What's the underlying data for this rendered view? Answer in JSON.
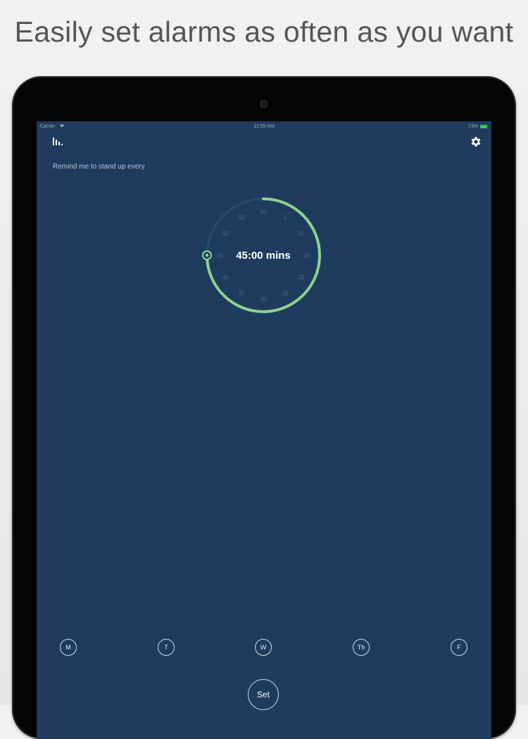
{
  "headline": "Easily set alarms as often as you want",
  "status_bar": {
    "carrier": "Carrier",
    "time": "12:55 AM",
    "battery": "73%"
  },
  "icons": {
    "stats": "bar-chart-icon",
    "settings": "gear-icon",
    "wifi": "wifi-icon"
  },
  "prompt": "Remind me to stand up every",
  "timer": {
    "display": "45:00 mins",
    "minutes_selected": 45,
    "tick_labels": [
      "50",
      "5",
      "10",
      "15",
      "20",
      "25",
      "30",
      "35",
      "40",
      "45",
      "50",
      "55"
    ],
    "accent_color": "#8fd18f",
    "track_color": "#2c4a6d"
  },
  "days": [
    "M",
    "T",
    "W",
    "Th",
    "F"
  ],
  "set_button": "Set",
  "colors": {
    "screen_bg": "#1f3c5e",
    "accent": "#8fd18f"
  }
}
